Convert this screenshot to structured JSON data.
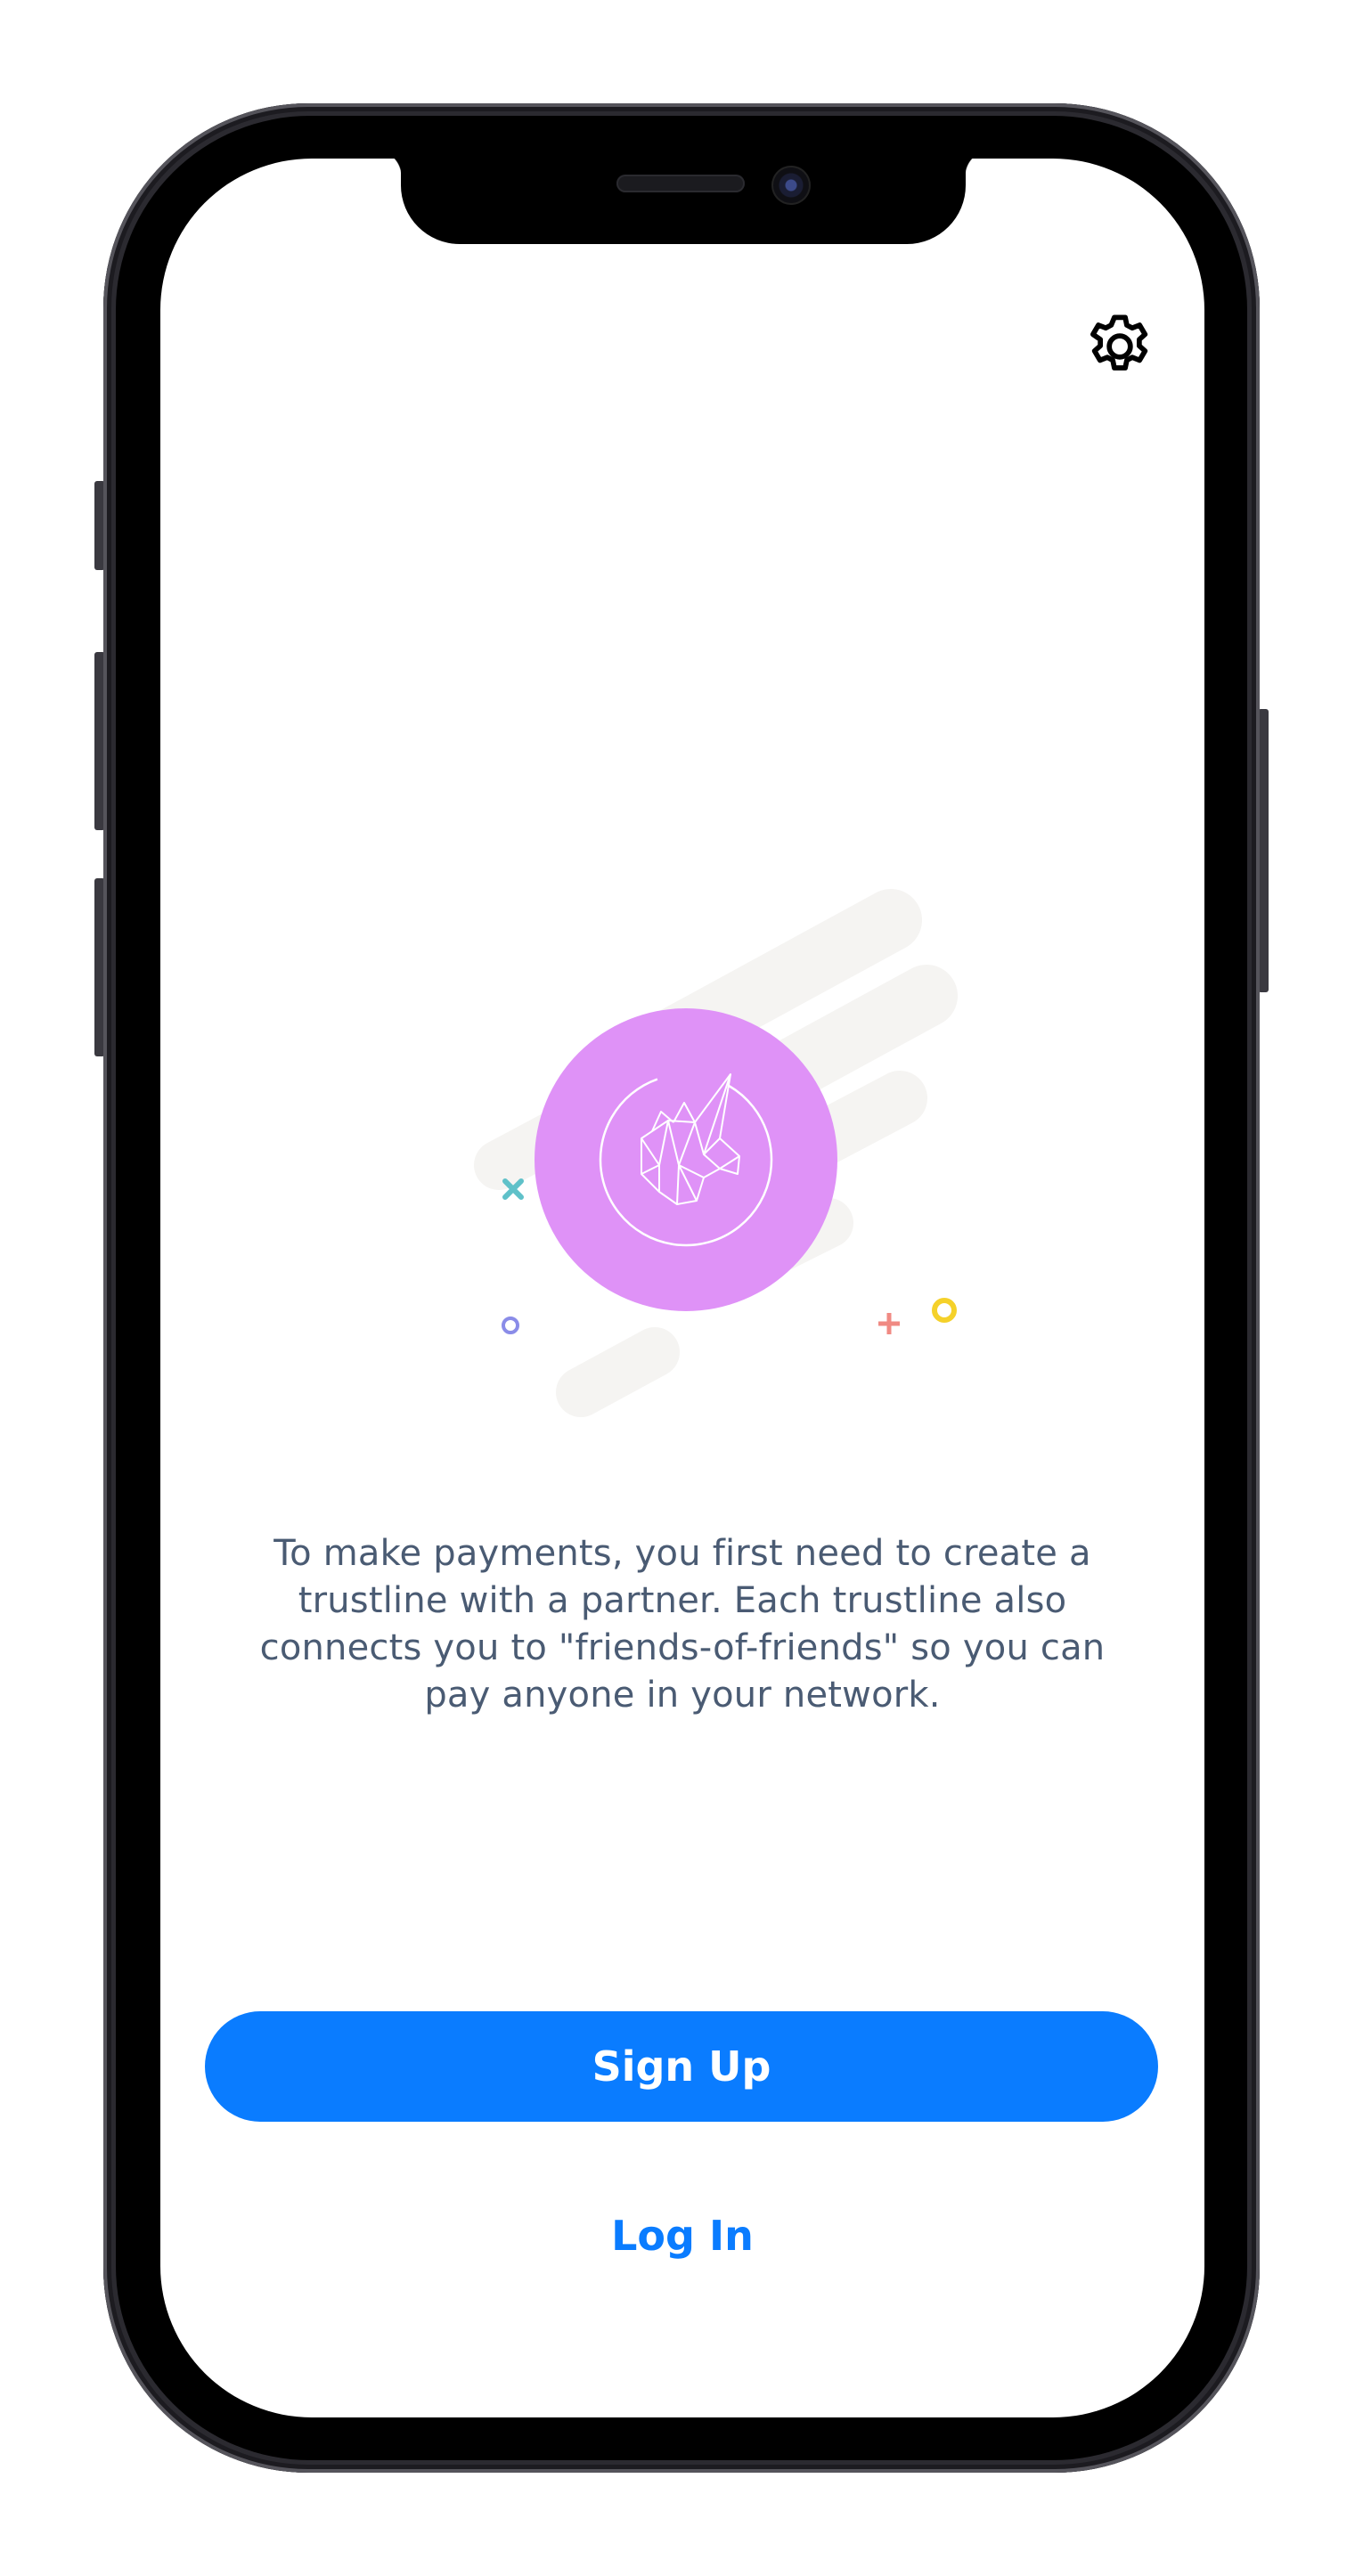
{
  "settings": {
    "icon": "gear-icon"
  },
  "hero": {
    "icon": "unicorn-icon",
    "colors": {
      "circle": "#df92f7",
      "streaks": "#f5f4f2",
      "accent_teal": "#5fc1c9",
      "accent_purple": "#c96bf3",
      "accent_red": "#f08a83",
      "accent_yellow": "#f5d12a",
      "accent_blue": "#8a8ce8"
    }
  },
  "message": "To make payments, you first need to create a trustline with a partner. Each trustline also connects you to \"friends-of-friends\" so you can pay anyone in your network.",
  "actions": {
    "primary_label": "Sign Up",
    "secondary_label": "Log In"
  },
  "colors": {
    "primary": "#0a7cff",
    "text": "#4a5b73"
  }
}
